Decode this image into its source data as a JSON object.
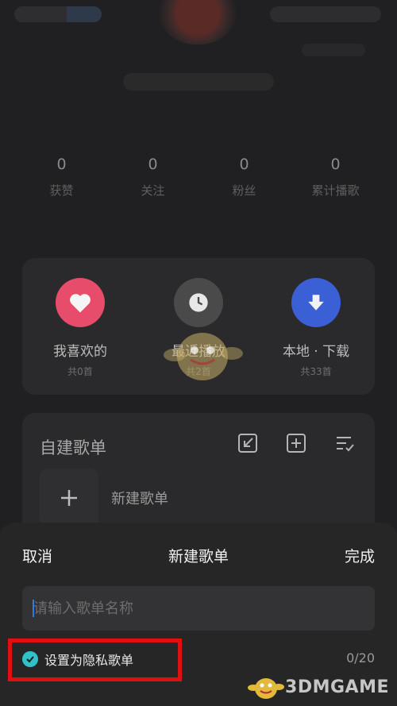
{
  "stats": [
    {
      "value": "0",
      "label": "获赞"
    },
    {
      "value": "0",
      "label": "关注"
    },
    {
      "value": "0",
      "label": "粉丝"
    },
    {
      "value": "0",
      "label": "累计播歌"
    }
  ],
  "quick_access": [
    {
      "title": "我喜欢的",
      "sub": "共0首",
      "icon": "heart-icon",
      "color": "#e84c6b"
    },
    {
      "title": "最近播放",
      "sub": "共2首",
      "icon": "clock-icon",
      "color": "#4a4a4a"
    },
    {
      "title": "本地 · 下载",
      "sub": "共33首",
      "icon": "download-icon",
      "color": "#3b5fd4"
    }
  ],
  "playlists": {
    "title": "自建歌单",
    "new_label": "新建歌单"
  },
  "sheet": {
    "cancel": "取消",
    "title": "新建歌单",
    "done": "完成",
    "placeholder": "请输入歌单名称",
    "private_label": "设置为隐私歌单",
    "private_checked": true,
    "counter": "0/20",
    "accent": "#2fc2c7"
  },
  "watermark": {
    "text": "3DMGAME"
  }
}
